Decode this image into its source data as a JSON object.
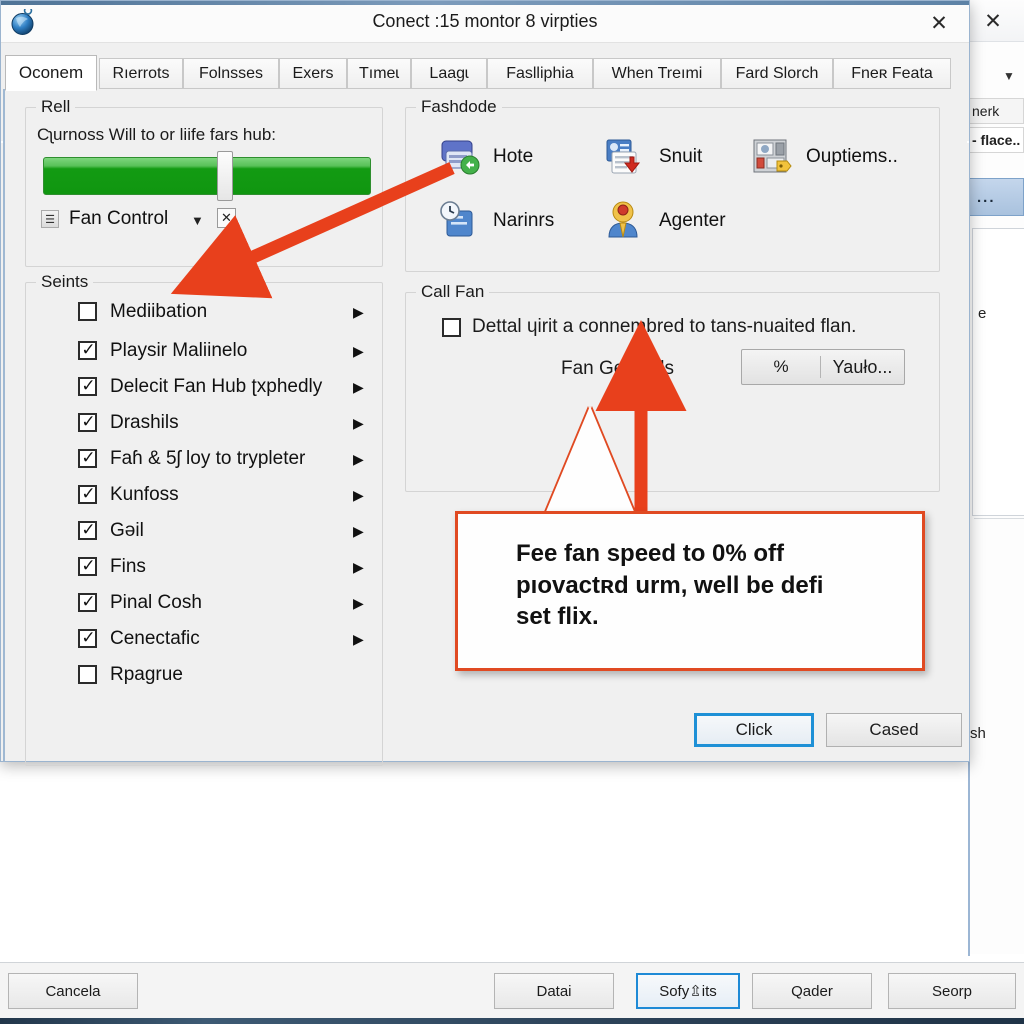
{
  "background_window": {
    "close_label": "✕",
    "chevron": "▼",
    "tab_stubs": [
      "nerk",
      "- flace.."
    ],
    "selected_list_item": "...",
    "panel_text": "e",
    "lower_text": "sh",
    "buttons": [
      {
        "label": "Cancela",
        "focused": false
      },
      {
        "label": "Datai",
        "focused": false
      },
      {
        "label": "Sofy⇫its",
        "focused": true
      },
      {
        "label": "Qader",
        "focused": false
      },
      {
        "label": "Seorp",
        "focused": false
      }
    ]
  },
  "dialog": {
    "title": "Conect :15 montor 8 virpties",
    "close_label": "✕",
    "app_icon": "globe-icon",
    "tabs": [
      {
        "label": "Oconem",
        "active": true
      },
      {
        "label": "Rıerrots",
        "active": false
      },
      {
        "label": "Folnsses",
        "active": false
      },
      {
        "label": "Exers",
        "active": false
      },
      {
        "label": "Tımeɩ",
        "active": false
      },
      {
        "label": "Laagɩ",
        "active": false
      },
      {
        "label": "Faslliphia",
        "active": false
      },
      {
        "label": "When Treımi",
        "active": false
      },
      {
        "label": "Fard Slorch",
        "active": false
      },
      {
        "label": "Fneʀ Feata",
        "active": false
      }
    ],
    "left_panel": {
      "group_title": "Rell",
      "description": "Cʅurnoss Will to or liife fars hub:",
      "slider": {
        "value_percent": 53,
        "color": "#109610"
      },
      "combo": {
        "value": "Fan Control",
        "arrow": "▼",
        "clear": "✕",
        "prefix_icon": "grip-icon"
      }
    },
    "settings_group": {
      "group_title": "Seints",
      "items": [
        {
          "label": "Mediibation",
          "checked": false,
          "arrow": "▶"
        },
        {
          "label": "Playsir Maliinelo",
          "checked": true,
          "arrow": "▶"
        },
        {
          "label": "Delecit Fan Hub ʈxphedly",
          "checked": true,
          "arrow": "▶"
        },
        {
          "label": "Drashils",
          "checked": true,
          "arrow": "▶"
        },
        {
          "label": "Faɦ & 5ʃ loy to trypleter",
          "checked": true,
          "arrow": "▶"
        },
        {
          "label": "Kunfoss",
          "checked": true,
          "arrow": "▶"
        },
        {
          "label": "Gəil",
          "checked": true,
          "arrow": "▶"
        },
        {
          "label": "Fins",
          "checked": true,
          "arrow": "▶"
        },
        {
          "label": "Pinal Cosh",
          "checked": true,
          "arrow": "▶"
        },
        {
          "label": "Cenectafic",
          "checked": true,
          "arrow": "▶"
        },
        {
          "label": "Rpagrue",
          "checked": false,
          "arrow": ""
        }
      ]
    },
    "mode_group": {
      "group_title": "Fashdode",
      "items": [
        {
          "label": "Hote",
          "icon": "monitor-sync-icon"
        },
        {
          "label": "Snuit",
          "icon": "document-download-icon"
        },
        {
          "label": "Ouptiems..",
          "icon": "window-tag-icon"
        },
        {
          "label": "Narinrs",
          "icon": "clock-screen-icon"
        },
        {
          "label": "Agenter",
          "icon": "user-key-icon"
        }
      ]
    },
    "call_fan_group": {
      "group_title": "Call Fan",
      "checkbox": {
        "label": "Dettal ɥirit a connembred to tans-nuaited flan.",
        "checked": false
      },
      "field_label": "Fan Gerticels",
      "spinner": {
        "unit": "%",
        "value": "Yauło..."
      }
    },
    "footer_buttons": [
      {
        "label": "Click",
        "primary": true
      },
      {
        "label": "Cased",
        "primary": false
      }
    ]
  },
  "annotations": {
    "callout_lines": [
      "Fee fan speed to 0% off",
      "pıovactʀd urm, well be defi",
      "set flix."
    ],
    "accent_color": "#e8401c",
    "arrow_to_mode_icon": "red-arrow-icon",
    "arrow_to_fan_field": "red-arrow-up-icon"
  }
}
